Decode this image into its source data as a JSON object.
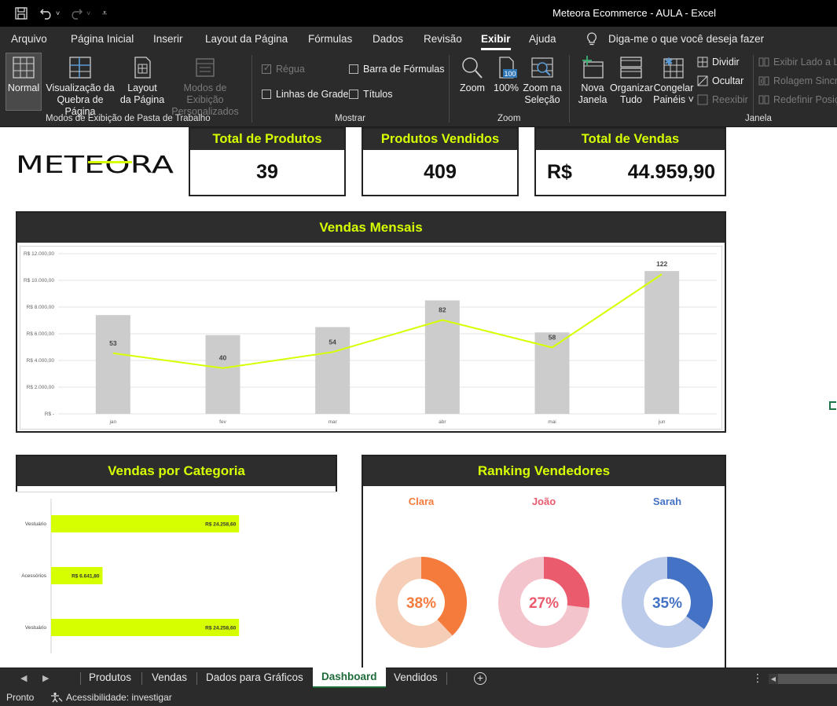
{
  "window": {
    "title": "Meteora Ecommerce - AULA  -  Excel"
  },
  "menu": {
    "tabs": [
      "Arquivo",
      "Página Inicial",
      "Inserir",
      "Layout da Página",
      "Fórmulas",
      "Dados",
      "Revisão",
      "Exibir",
      "Ajuda"
    ],
    "active": "Exibir",
    "tell_me": "Diga-me o que você deseja fazer"
  },
  "ribbon": {
    "workbook_views": {
      "normal": "Normal",
      "page_break": [
        "Visualização da",
        "Quebra de Página"
      ],
      "page_layout": [
        "Layout",
        "da Página"
      ],
      "custom_views": [
        "Modos de Exibição",
        "Personalizados"
      ],
      "group_label": "Modos de Exibição de Pasta de Trabalho"
    },
    "show": {
      "ruler": "Régua",
      "gridlines": "Linhas de Grade",
      "formula_bar": "Barra de Fórmulas",
      "headings": "Títulos",
      "group_label": "Mostrar"
    },
    "zoom": {
      "zoom": "Zoom",
      "hundred": "100%",
      "hundred_icon": "100",
      "zoom_selection": [
        "Zoom na",
        "Seleção"
      ],
      "group_label": "Zoom"
    },
    "window": {
      "new_window": [
        "Nova",
        "Janela"
      ],
      "arrange_all": [
        "Organizar",
        "Tudo"
      ],
      "freeze_panes": [
        "Congelar",
        "Painéis ˅"
      ],
      "split": "Dividir",
      "hide": "Ocultar",
      "unhide": "Reexibir",
      "side_by_side": "Exibir Lado a La",
      "sync_scroll": "Rolagem Sincro",
      "reset_position": "Redefinir Posiç",
      "group_label": "Janela"
    }
  },
  "dashboard": {
    "logo_text": "METEORA",
    "kpis": {
      "total_produtos": {
        "label": "Total de Produtos",
        "value": "39"
      },
      "produtos_vendidos": {
        "label": "Produtos  Vendidos",
        "value": "409"
      },
      "total_vendas": {
        "label": "Total de Vendas",
        "currency": "R$",
        "value": "44.959,90"
      }
    },
    "monthly_title": "Vendas Mensais",
    "category_title": "Vendas por Categoria",
    "ranking_title": "Ranking Vendedores"
  },
  "chart_data": [
    {
      "type": "bar",
      "title": "Vendas Mensais",
      "categories": [
        "jan",
        "fev",
        "mar",
        "abr",
        "mai",
        "jun"
      ],
      "ylim": [
        0,
        12000
      ],
      "yticks": [
        "R$ -",
        "R$ 2.000,00",
        "R$ 4.000,00",
        "R$ 6.000,00",
        "R$ 8.000,00",
        "R$ 10.000,00",
        "R$ 12.000,00"
      ],
      "grid": true,
      "series": [
        {
          "kind": "bar",
          "color": "#cccccc",
          "values": [
            7400,
            5900,
            6500,
            8500,
            6100,
            10700
          ]
        },
        {
          "kind": "line",
          "color": "#d6ff00",
          "values": [
            53,
            40,
            54,
            82,
            58,
            122
          ],
          "ylim": [
            0,
            140
          ]
        }
      ]
    },
    {
      "type": "bar",
      "orientation": "horizontal",
      "title": "Vendas por Categoria",
      "categories": [
        "Vestuário",
        "Acessórios",
        "Vestuário"
      ],
      "values": [
        24258.6,
        6641.8,
        24258.6
      ],
      "value_labels": [
        "R$ 24.258,60",
        "R$ 6.641,80",
        "R$ 24.258,60"
      ],
      "xlim": [
        0,
        36000
      ],
      "color": "#d6ff00"
    },
    {
      "type": "pie",
      "title": "Ranking Vendedores",
      "donuts": [
        {
          "name": "Clara",
          "percent": 38,
          "label": "38%",
          "color": "#f47b3c",
          "track": "#f6cdb6"
        },
        {
          "name": "João",
          "percent": 27,
          "label": "27%",
          "color": "#ea5b6d",
          "track": "#f4c4cc"
        },
        {
          "name": "Sarah",
          "percent": 35,
          "label": "35%",
          "color": "#4472c4",
          "track": "#bccbea"
        }
      ]
    }
  ],
  "sheet_tabs": {
    "tabs": [
      "Produtos",
      "Vendas",
      "Dados para Gráficos",
      "Dashboard",
      "Vendidos"
    ],
    "active": "Dashboard"
  },
  "status": {
    "ready": "Pronto",
    "accessibility": "Acessibilidade: investigar"
  }
}
